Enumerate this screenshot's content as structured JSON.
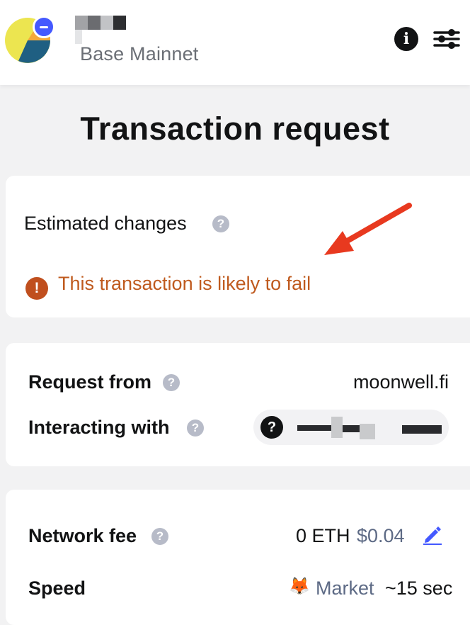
{
  "header": {
    "network_name": "Base Mainnet",
    "info_icon_label": "i"
  },
  "page": {
    "title": "Transaction request"
  },
  "estimated_changes": {
    "label": "Estimated changes",
    "help_glyph": "?",
    "warning_glyph": "!",
    "warning_text": "This transaction is likely to fail"
  },
  "request": {
    "request_from_label": "Request from",
    "request_from_value": "moonwell.fi",
    "interacting_with_label": "Interacting with",
    "interacting_with_icon_glyph": "?",
    "help_glyph": "?"
  },
  "fees": {
    "network_fee_label": "Network fee",
    "network_fee_eth": "0 ETH",
    "network_fee_usd": "$0.04",
    "speed_label": "Speed",
    "speed_value": "Market",
    "speed_time": "~15 sec",
    "help_glyph": "?"
  },
  "colors": {
    "accent": "#4459ff",
    "warning": "#bf5a1e",
    "arrow": "#e8391f"
  }
}
